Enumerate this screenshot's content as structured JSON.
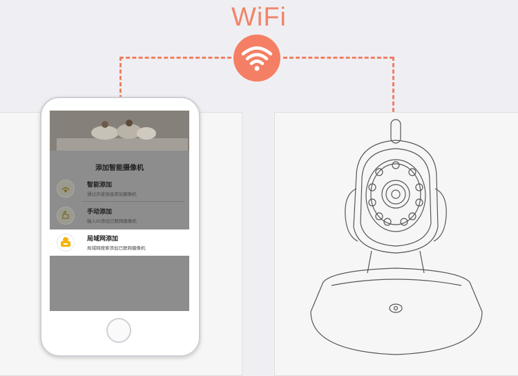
{
  "header": {
    "wifi_label": "WiFi"
  },
  "phone": {
    "menu_title": "添加智能摄像机",
    "items": [
      {
        "title": "智能添加",
        "subtitle": "通过声波连接添加摄像机"
      },
      {
        "title": "手动添加",
        "subtitle": "输入ID添加已联网摄像机"
      },
      {
        "title": "局域网添加",
        "subtitle": "局域网搜索添加已联网摄像机"
      }
    ]
  },
  "colors": {
    "accent": "#f47f64",
    "selected_icon": "#f5b400"
  }
}
